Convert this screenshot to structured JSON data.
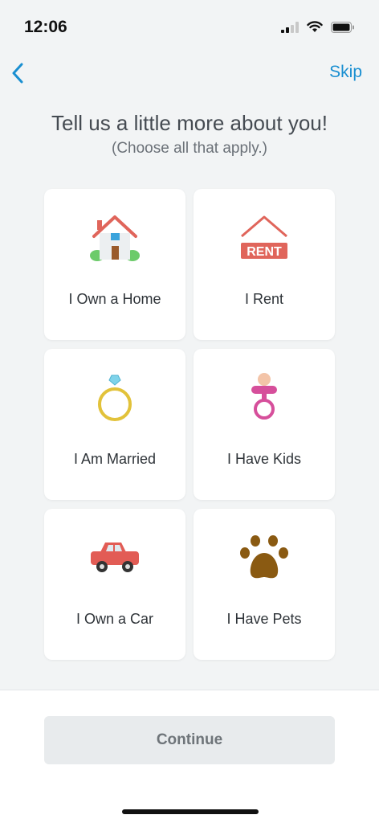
{
  "status_bar": {
    "time": "12:06"
  },
  "nav": {
    "skip_label": "Skip"
  },
  "header": {
    "title": "Tell us a little more about you!",
    "subtitle": "(Choose all that apply.)"
  },
  "options": [
    {
      "label": "I Own a Home",
      "icon": "house-icon"
    },
    {
      "label": "I Rent",
      "icon": "rent-sign-icon",
      "icon_text": "RENT"
    },
    {
      "label": "I Am Married",
      "icon": "ring-icon"
    },
    {
      "label": "I Have Kids",
      "icon": "pacifier-icon"
    },
    {
      "label": "I Own a Car",
      "icon": "car-icon"
    },
    {
      "label": "I Have Pets",
      "icon": "paw-icon"
    }
  ],
  "footer": {
    "continue_label": "Continue"
  },
  "colors": {
    "accent": "#1a8fd1",
    "rent_red": "#e0655b",
    "ring_gold": "#e2c23a",
    "pacifier_pink": "#d64f9b",
    "paw_brown": "#8a5a12",
    "car_red": "#e25c55"
  }
}
